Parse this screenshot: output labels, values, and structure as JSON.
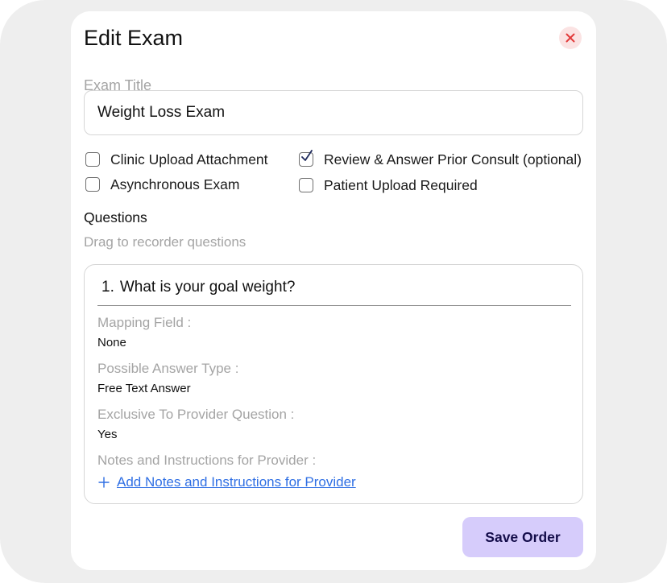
{
  "modal": {
    "title": "Edit Exam",
    "close_icon": "close-icon",
    "colors": {
      "close_bg": "#fbe3e3",
      "close_x": "#e23b3b",
      "link": "#2f6fe4",
      "save_bg": "#d6ccfb",
      "save_text": "#140d4a"
    }
  },
  "exam_title": {
    "label": "Exam Title",
    "value": "Weight Loss Exam"
  },
  "options": [
    {
      "label": "Clinic Upload Attachment",
      "checked": false
    },
    {
      "label": "Asynchronous Exam",
      "checked": false
    },
    {
      "label": "Review & Answer Prior Consult (optional)",
      "checked": true
    },
    {
      "label": "Patient Upload Required",
      "checked": false
    }
  ],
  "questions": {
    "title": "Questions",
    "hint": "Drag to recorder questions",
    "items": [
      {
        "number": "1.",
        "text": "What is your goal weight?",
        "mapping_label": "Mapping Field :",
        "mapping_value": "None",
        "answer_type_label": "Possible Answer Type :",
        "answer_type_value": "Free Text Answer",
        "exclusive_label": "Exclusive To Provider Question :",
        "exclusive_value": "Yes",
        "notes_label": "Notes and Instructions for Provider :",
        "add_notes_label": "Add Notes and Instructions for Provider",
        "add_icon": "plus-icon"
      }
    ]
  },
  "footer": {
    "save_label": "Save Order"
  }
}
